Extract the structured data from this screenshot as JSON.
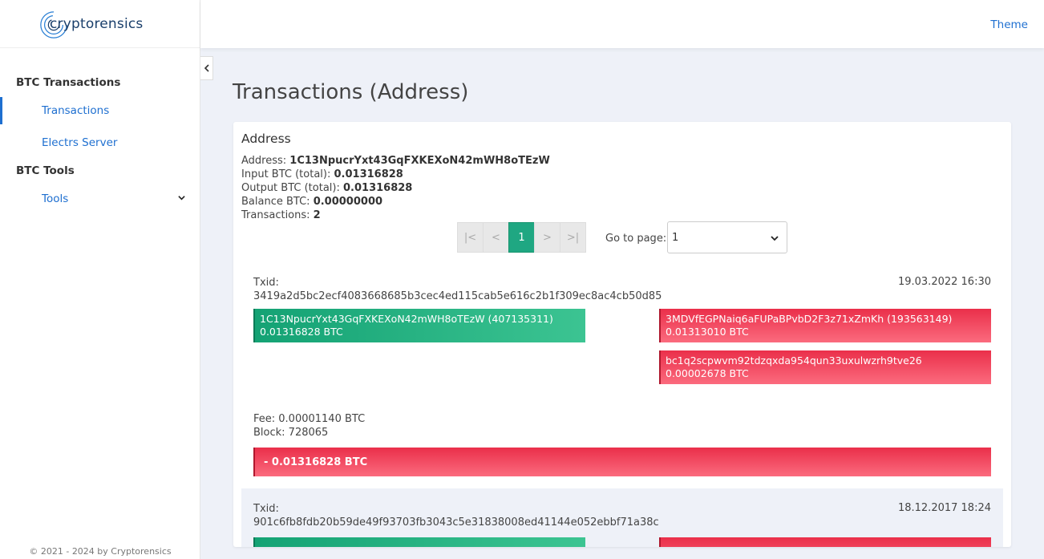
{
  "app": {
    "logo_text": "cryptorensics",
    "theme_label": "Theme",
    "footer": "© 2021 - 2024 by Cryptorensics"
  },
  "sidebar": {
    "groups": [
      {
        "label": "BTC Transactions",
        "items": [
          {
            "label": "Transactions",
            "active": true
          },
          {
            "label": "Electrs Server"
          }
        ]
      },
      {
        "label": "BTC Tools",
        "items": [
          {
            "label": "Tools"
          }
        ]
      }
    ]
  },
  "page": {
    "title": "Transactions (Address)"
  },
  "address_card": {
    "title": "Address",
    "address_label": "Address:",
    "address": "1C13NpucrYxt43GqFXKEXoN42mWH8oTEzW",
    "input_label": "Input BTC (total):",
    "input_total": "0.01316828",
    "output_label": "Output BTC (total):",
    "output_total": "0.01316828",
    "balance_label": "Balance BTC:",
    "balance": "0.00000000",
    "tx_label": "Transactions:",
    "tx_count": "2"
  },
  "pagination": {
    "first": "|<",
    "prev": "<",
    "current": "1",
    "next": ">",
    "last": ">|",
    "goto_label": "Go to page:",
    "goto_value": "1"
  },
  "transactions": [
    {
      "txid_label": "Txid:",
      "txid": "3419a2d5bc2ecf4083668685b3cec4ed115cab5e616c2b1f309ec8ac4cb50d85",
      "date": "19.03.2022 16:30",
      "inputs": [
        {
          "address": "1C13NpucrYxt43GqFXKEXoN42mWH8oTEzW (407135311)",
          "amount": "0.01316828 BTC"
        }
      ],
      "outputs": [
        {
          "address": "3MDVfEGPNaiq6aFUPaBPvbD2F3z71xZmKh (193563149)",
          "amount": "0.01313010 BTC"
        },
        {
          "address": "bc1q2scpwvm92tdzqxda954qun33uxulwzrh9tve26",
          "amount": "0.00002678 BTC"
        }
      ],
      "fee": "Fee: 0.00001140 BTC",
      "block": "Block: 728065",
      "balance_change": "- 0.01316828 BTC"
    },
    {
      "txid_label": "Txid:",
      "txid": "901c6fb8fdb20b59de49f93703fb3043c5e31838008ed41144e052ebbf71a38c",
      "date": "18.12.2017 18:24"
    }
  ],
  "colors": {
    "accent": "#1e6fd0",
    "input_green": "#14a274",
    "output_red": "#ea2f4a",
    "page_bg": "#eef1f8"
  }
}
